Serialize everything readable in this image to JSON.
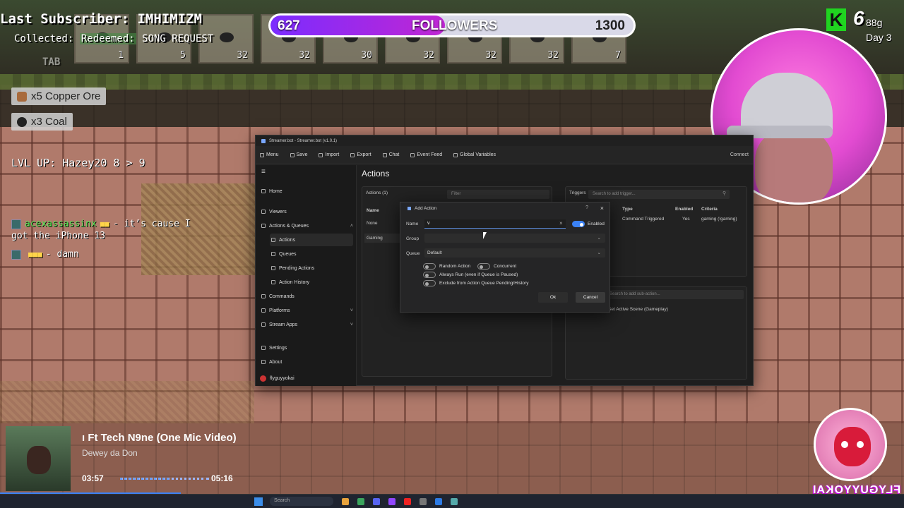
{
  "overlay": {
    "last_subscriber": "Last Subscriber: IMHIMIZM",
    "collected_label": "Collected:",
    "redeemed_label": "Redeemed:",
    "redeemed_value": "SONG REQUEST",
    "tab_label": "TAB",
    "followers": {
      "current": "627",
      "label": "FOLLOWERS",
      "goal": "1300",
      "fraction": 0.48
    },
    "hotbar_counts": [
      "1",
      "5",
      "32",
      "32",
      "30",
      "32",
      "32",
      "32",
      "7"
    ],
    "drops": [
      {
        "text": "x5 Copper Ore",
        "icon": "copper-ore-icon"
      },
      {
        "text": "x3 Coal",
        "icon": "coal-icon"
      }
    ],
    "level_up": "LVL UP: Hazey20 8 > 9",
    "chat": [
      {
        "name": "acexassassinx",
        "message": "- it’s cause I",
        "message2": "got the iPhone 13"
      },
      {
        "name": "",
        "message": "- damn"
      }
    ],
    "k_count": "6",
    "gold": "88g",
    "day": "Day 3"
  },
  "streamerbot": {
    "window_title": "Streamer.bot - Streamer.bot (v1.0.1)",
    "menu": [
      "Menu",
      "Save",
      "Import",
      "Export",
      "Chat",
      "Event Feed",
      "Global Variables"
    ],
    "connection": "Connect",
    "sidebar": [
      {
        "label": "Home",
        "sub": false
      },
      {
        "label": "Viewers",
        "sub": false
      },
      {
        "label": "Actions & Queues",
        "sub": false
      },
      {
        "label": "Actions",
        "sub": true
      },
      {
        "label": "Queues",
        "sub": true
      },
      {
        "label": "Pending Actions",
        "sub": true
      },
      {
        "label": "Action History",
        "sub": true
      },
      {
        "label": "Commands",
        "sub": false
      },
      {
        "label": "Platforms",
        "sub": false
      },
      {
        "label": "Stream Apps",
        "sub": false
      },
      {
        "label": "Settings",
        "sub": false
      },
      {
        "label": "About",
        "sub": false
      }
    ],
    "user": "flyguyyokai",
    "page_title": "Actions",
    "actions_panel": {
      "header": "Actions (1)",
      "filter_placeholder": "Filter",
      "col_name": "Name",
      "rows": [
        "None",
        "Gaming"
      ]
    },
    "triggers_panel": {
      "header": "Triggers",
      "search_placeholder": "Search to add trigger...",
      "cols": [
        "Type",
        "Enabled",
        "Criteria"
      ],
      "row": [
        "Command Triggered",
        "Yes",
        "gaming (!gaming)"
      ]
    },
    "subactions": {
      "search_placeholder": "Search to add sub-action...",
      "item": "Set Active Scene (Gameplay)"
    }
  },
  "dialog": {
    "title": "Add Action",
    "name_label": "Name",
    "name_value": "v",
    "enabled_label": "Enabled",
    "group_label": "Group",
    "group_value": "",
    "queue_label": "Queue",
    "queue_value": "Default",
    "random_action": "Random Action",
    "concurrent": "Concurrent",
    "always_run": "Always Run (even if Queue is Paused)",
    "exclude": "Exclude from Action Queue Pending/History",
    "ok": "Ok",
    "cancel": "Cancel"
  },
  "music": {
    "title": "ı Ft Tech N9ne (One Mic Video)",
    "artist": "Dewey da Don",
    "elapsed": "03:57",
    "duration": "05:16",
    "progress": 0.55
  },
  "branding": {
    "logo_text": "FLYGUYYOKAI"
  },
  "taskbar": {
    "search": "Search"
  }
}
